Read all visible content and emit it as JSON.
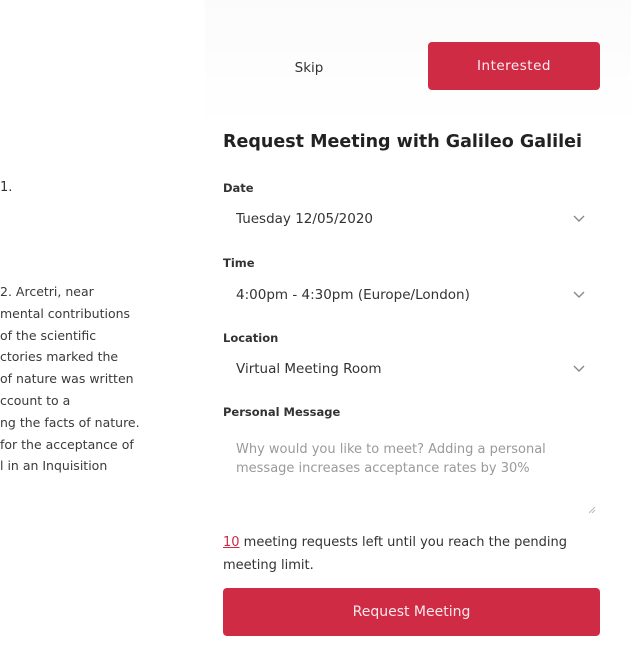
{
  "left": {
    "fragment": "1.",
    "bio_lines": [
      "2. Arcetri, near",
      "mental contributions",
      " of the scientific",
      "ctories marked the",
      "of nature was written",
      "ccount to a",
      "ng the facts of nature.",
      "for the acceptance of",
      "l in an Inquisition"
    ]
  },
  "actions": {
    "skip_label": "Skip",
    "interested_label": "Interested"
  },
  "form": {
    "title": "Request Meeting with Galileo Galilei",
    "date_label": "Date",
    "date_value": "Tuesday 12/05/2020",
    "time_label": "Time",
    "time_value": "4:00pm - 4:30pm (Europe/London)",
    "location_label": "Location",
    "location_value": "Virtual Meeting Room",
    "message_label": "Personal Message",
    "message_placeholder": "Why would you like to meet? Adding a personal message increases acceptance rates by 30%",
    "limit_count": "10",
    "limit_text": " meeting requests left until you reach the pending meeting limit.",
    "submit_label": "Request Meeting"
  },
  "colors": {
    "accent": "#cf2b45"
  },
  "icons": {
    "dropdown": "chevron-down-icon",
    "resize": "resize-handle-icon"
  }
}
